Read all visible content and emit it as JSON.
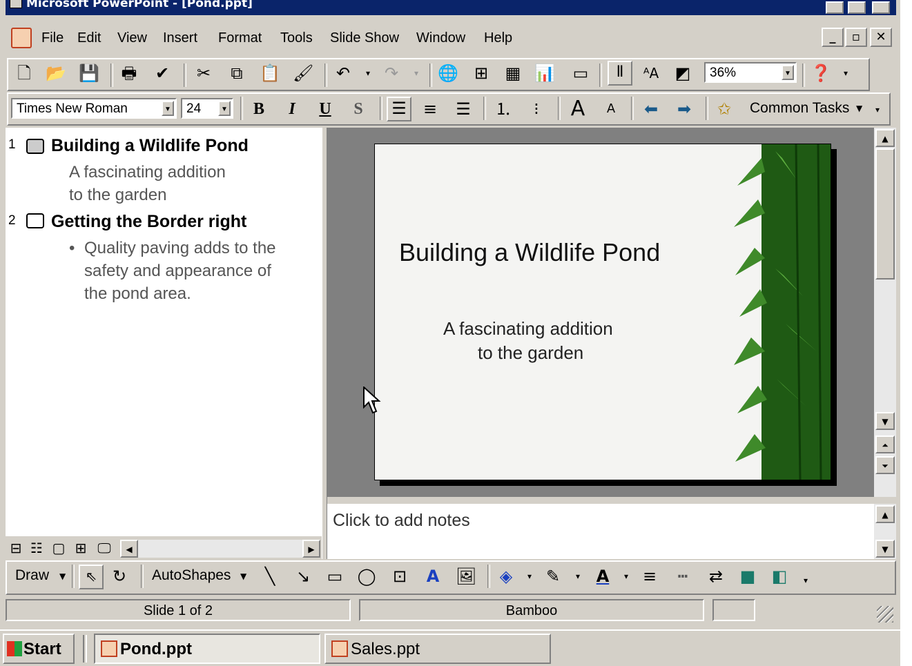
{
  "window": {
    "title": "Microsoft PowerPoint - [Pond.ppt]"
  },
  "menu": {
    "items": [
      "File",
      "Edit",
      "View",
      "Insert",
      "Format",
      "Tools",
      "Slide Show",
      "Window",
      "Help"
    ]
  },
  "standard_toolbar": {
    "zoom": "36%"
  },
  "formatting_toolbar": {
    "font": "Times New Roman",
    "size": "24",
    "bold": "B",
    "italic": "I",
    "underline": "U",
    "shadow": "S",
    "common_tasks": "Common Tasks"
  },
  "outline": {
    "slides": [
      {
        "number": "1",
        "title": "Building a Wildlife Pond",
        "lines": [
          "A fascinating addition",
          "to the garden"
        ]
      },
      {
        "number": "2",
        "title": "Getting the Border right",
        "bullet": "•",
        "lines": [
          "Quality paving adds to the",
          "safety and appearance of",
          "the pond area."
        ]
      }
    ]
  },
  "slide": {
    "title": "Building a Wildlife Pond",
    "subtitle_line1": "A fascinating addition",
    "subtitle_line2": "to the garden"
  },
  "notes": {
    "placeholder": "Click to add notes"
  },
  "drawing_toolbar": {
    "draw": "Draw",
    "autoshapes": "AutoShapes"
  },
  "status": {
    "slide": "Slide 1 of 2",
    "design": "Bamboo"
  },
  "taskbar": {
    "start": "Start",
    "tasks": [
      "Pond.ppt",
      "Sales.ppt"
    ]
  },
  "colors": {
    "title_bar": "#0a246a",
    "chrome": "#d4d0c8",
    "bamboo_green": "#2e6b1f"
  }
}
